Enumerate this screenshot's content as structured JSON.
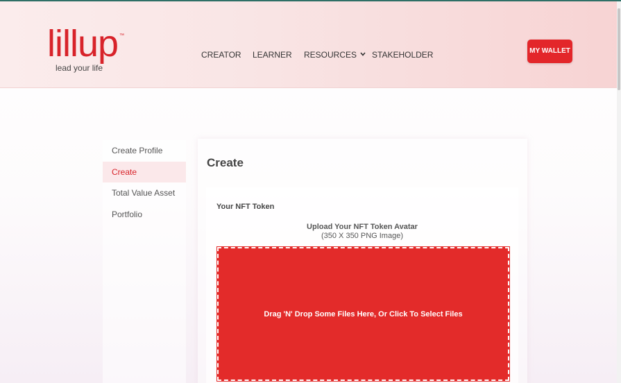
{
  "brand": {
    "logo_text": "lillup",
    "tm": "™",
    "tagline": "lead your life",
    "color": "#d8232a"
  },
  "nav": {
    "items": [
      {
        "label": "CREATOR"
      },
      {
        "label": "LEARNER"
      },
      {
        "label": "RESOURCES",
        "has_dropdown": true,
        "icon": "chevron-down-icon"
      },
      {
        "label": "STAKEHOLDER"
      }
    ],
    "wallet_button": "MY WALLET"
  },
  "sidebar": {
    "items": [
      {
        "label": "Create Profile",
        "active": false
      },
      {
        "label": "Create",
        "active": true
      },
      {
        "label": "Total Value Asset",
        "active": false
      },
      {
        "label": "Portfolio",
        "active": false
      }
    ]
  },
  "main": {
    "title": "Create",
    "card": {
      "label": "Your NFT Token",
      "upload_title": "Upload Your NFT Token Avatar",
      "upload_subtitle": "(350 X 350 PNG Image)",
      "dropzone_text": "Drag 'N' Drop Some Files Here, Or Click To Select Files"
    }
  },
  "colors": {
    "accent": "#e3262a",
    "active_bg": "#fbe8ea"
  }
}
